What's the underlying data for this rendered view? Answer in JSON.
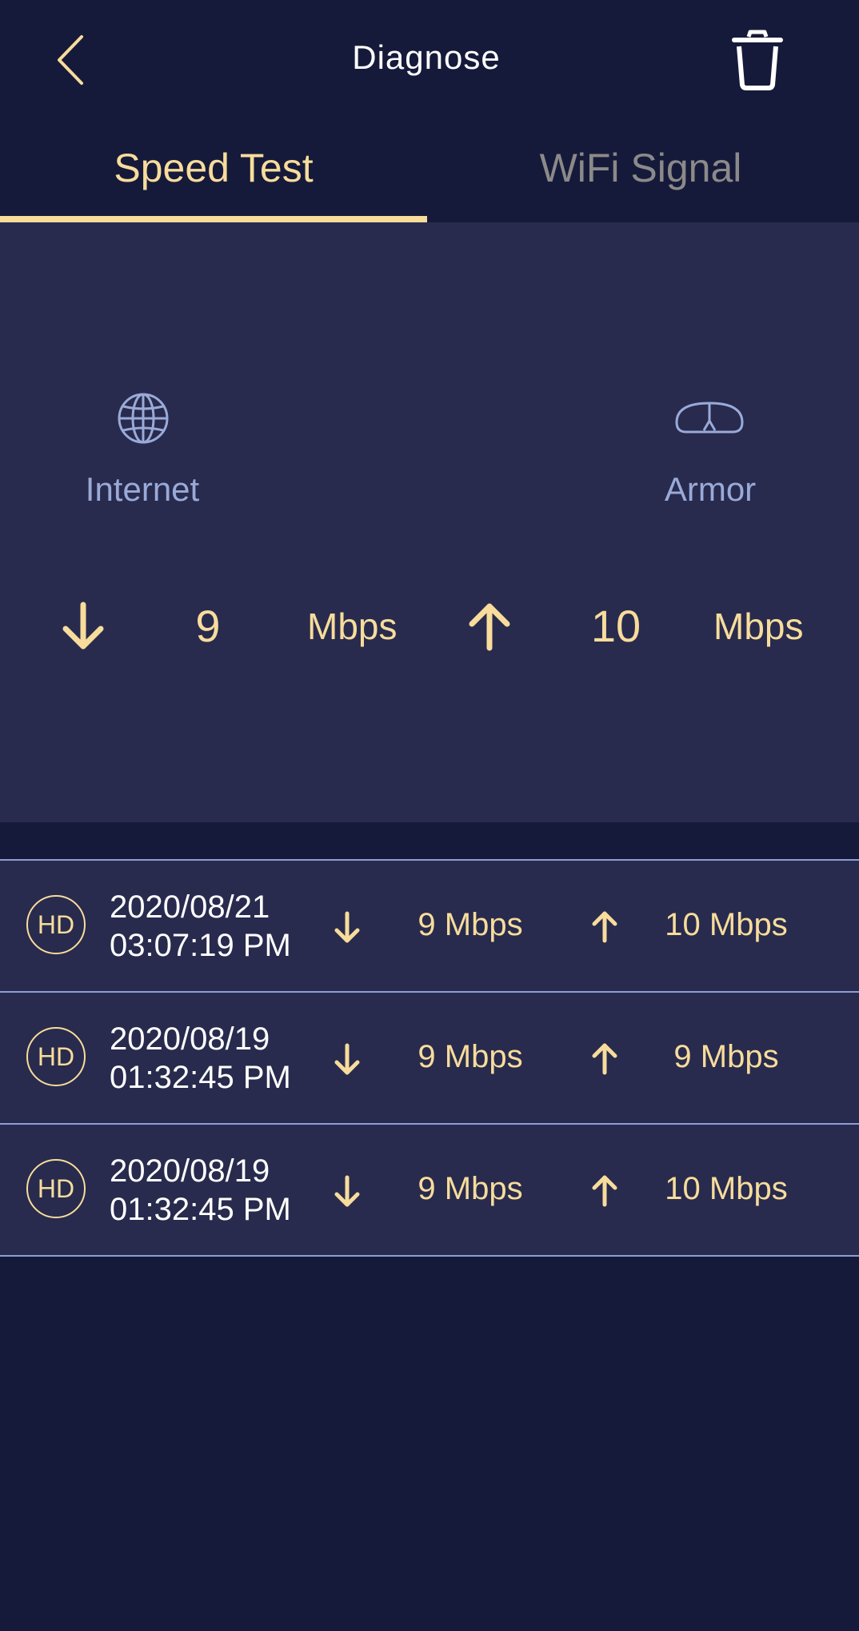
{
  "header": {
    "title": "Diagnose"
  },
  "tabs": [
    {
      "label": "Speed Test",
      "active": true
    },
    {
      "label": "WiFi Signal",
      "active": false
    }
  ],
  "speedtest": {
    "source_label": "Internet",
    "target_label": "Armor",
    "download_value": "9",
    "download_unit": "Mbps",
    "upload_value": "10",
    "upload_unit": "Mbps"
  },
  "history": [
    {
      "badge": "HD",
      "date": "2020/08/21",
      "time": "03:07:19 PM",
      "download": "9 Mbps",
      "upload": "10 Mbps"
    },
    {
      "badge": "HD",
      "date": "2020/08/19",
      "time": "01:32:45 PM",
      "download": "9 Mbps",
      "upload": "9 Mbps"
    },
    {
      "badge": "HD",
      "date": "2020/08/19",
      "time": "01:32:45 PM",
      "download": "9 Mbps",
      "upload": "10 Mbps"
    }
  ],
  "colors": {
    "background": "#161a3a",
    "panel": "#282b4d",
    "accent": "#f7dc9c",
    "muted_blue": "#9aaad8",
    "inactive_tab": "#8b8a8a",
    "divider": "#8d9ed6"
  },
  "icons": {
    "back": "chevron-left-icon",
    "delete": "trash-icon",
    "internet": "globe-icon",
    "device": "router-icon",
    "download": "arrow-down-icon",
    "upload": "arrow-up-icon"
  }
}
